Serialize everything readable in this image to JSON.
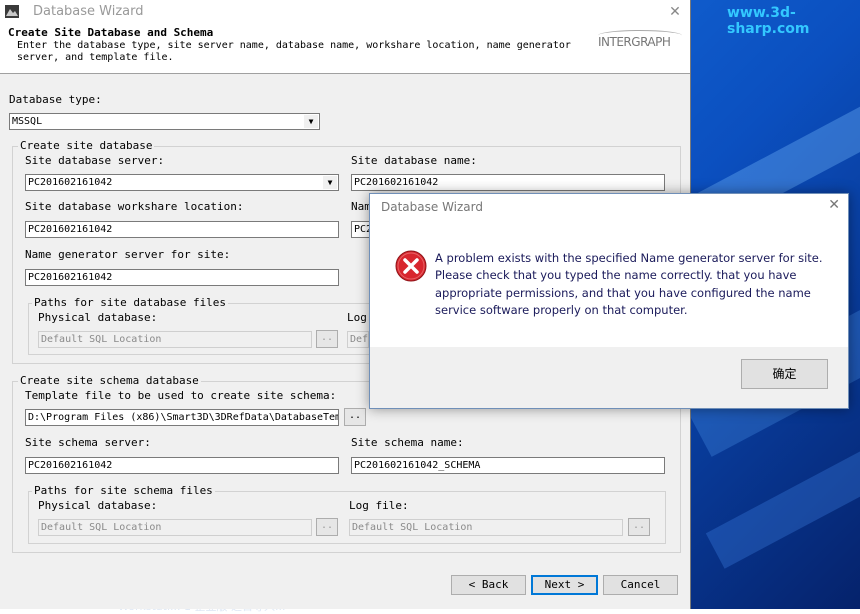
{
  "desktop": {
    "watermark": "www.3d-sharp.com",
    "taskbar_text": "Workstati... 1 企业版 之日导入..."
  },
  "wizard": {
    "title": "Database Wizard",
    "close": "✕",
    "header_title": "Create Site Database and Schema",
    "header_desc": "Enter the database type, site server name, database name, workshare location, name generator server, and template file.",
    "logo": "INTERGRAPH",
    "database_type_label": "Database type:",
    "database_type_value": "MSSQL",
    "site_group_title": "Create site database",
    "site_server_label": "Site database server:",
    "site_server_value": "PC201602161042",
    "site_name_label": "Site database name:",
    "site_name_value": "PC201602161042",
    "workshare_label": "Site database workshare location:",
    "workshare_value": "PC201602161042",
    "right2_label": "Nam",
    "right2_value": "PC2",
    "name_gen_label": "Name generator server for site:",
    "name_gen_value": "PC201602161042",
    "paths_site_title": "Paths for site database files",
    "phys_db_label": "Physical database:",
    "phys_db_value": "Default SQL Location",
    "log_label_partial": "Log",
    "log_value_partial": "Def",
    "schema_group_title": "Create site schema database",
    "template_label": "Template file to be used to create site schema:",
    "template_value": "D:\\Program Files (x86)\\Smart3D\\3DRefData\\DatabaseTem",
    "schema_server_label": "Site schema server:",
    "schema_server_value": "PC201602161042",
    "schema_name_label": "Site schema name:",
    "schema_name_value": "PC201602161042_SCHEMA",
    "paths_schema_title": "Paths for site schema files",
    "phys_db2_label": "Physical database:",
    "phys_db2_value": "Default SQL Location",
    "log_file_label": "Log file:",
    "log_file_value": "Default SQL Location",
    "browse": "..",
    "back": "< Back",
    "next": "Next >",
    "cancel": "Cancel"
  },
  "dialog": {
    "title": "Database Wizard",
    "close": "✕",
    "message": "A problem exists with the specified Name generator server for site. Please check that you typed the name correctly. that you have appropriate permissions, and that you have configured the name service software properly on that computer.",
    "ok": "确定",
    "icon": "error-icon",
    "icon_color": "#d8262e"
  }
}
